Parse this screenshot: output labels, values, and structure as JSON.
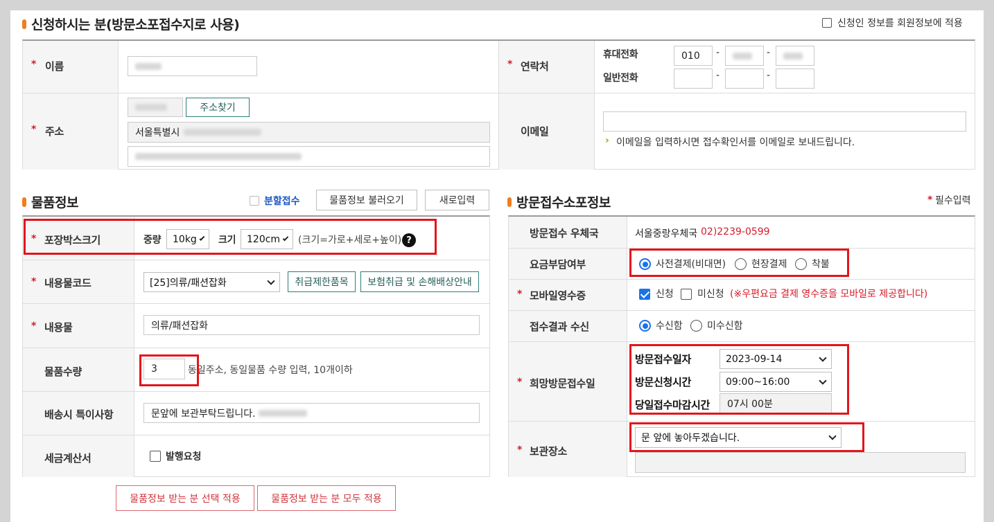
{
  "applicant": {
    "title": "신청하시는 분(방문소포접수지로 사용)",
    "apply_member_label": "신청인 정보를 회원정보에 적용",
    "name_label": "이름",
    "address_label": "주소",
    "address_search_button": "주소찾기",
    "address_line1": "서울특별시",
    "contact_label": "연락처",
    "mobile_label": "휴대전화",
    "mobile_prefix": "010",
    "landline_label": "일반전화",
    "dash": "-",
    "email_label": "이메일",
    "email_value": "",
    "email_note": "이메일을 입력하시면 접수확인서를 이메일로 보내드립니다."
  },
  "goods": {
    "title": "물품정보",
    "split_label": "분할접수",
    "load_button": "물품정보 불러오기",
    "new_button": "새로입력",
    "box_size_label": "포장박스크기",
    "weight_label": "중량",
    "weight_value": "10kg",
    "size_label": "크기",
    "size_value": "120cm",
    "size_note": "(크기=가로+세로+높이)",
    "help_icon": "?",
    "content_code_label": "내용물코드",
    "content_code_value": "[25]의류/패션잡화",
    "restricted_button": "취급제한품목",
    "insurance_button": "보험취급 및 손해배상안내",
    "content_label": "내용물",
    "content_value": "의류/패션잡화",
    "quantity_label": "물품수량",
    "quantity_value": "3",
    "quantity_note": "동일주소, 동일물품 수량 입력, 10개이하",
    "delivery_note_label": "배송시 특이사항",
    "delivery_note_value": "문앞에 보관부탁드립니다.",
    "tax_invoice_label": "세금계산서",
    "tax_invoice_option": "발행요청",
    "apply_selected_button": "물품정보 받는 분 선택 적용",
    "apply_all_button": "물품정보 받는 분 모두 적용"
  },
  "pickup": {
    "title": "방문접수소포정보",
    "required_note": "필수입력",
    "office_label": "방문접수 우체국",
    "office_name": "서울중랑우체국",
    "office_phone": "02)2239-0599",
    "payment_label": "요금부담여부",
    "payment_options": [
      "사전결제(비대면)",
      "현장결제",
      "착불"
    ],
    "payment_selected": 0,
    "receipt_label": "모바일영수증",
    "receipt_apply": "신청",
    "receipt_no": "미신청",
    "receipt_note": "(※우편요금 결제 영수증을 모바일로 제공합니다)",
    "result_label": "접수결과 수신",
    "result_yes": "수신함",
    "result_no": "미수신함",
    "wish_label": "희망방문접수일",
    "date_label": "방문접수일자",
    "date_value": "2023-09-14",
    "time_label": "방문신청시간",
    "time_value": "09:00~16:00",
    "deadline_label": "당일접수마감시간",
    "deadline_value": "07시 00분",
    "storage_label": "보관장소",
    "storage_value": "문 앞에 놓아두겠습니다.",
    "storage_detail": ""
  },
  "colors": {
    "accent_orange": "#f07c1e",
    "required_red": "#d61b2a",
    "highlight_red": "#e3141b",
    "teal": "#2a7e76",
    "link_blue": "#1a56c4"
  }
}
